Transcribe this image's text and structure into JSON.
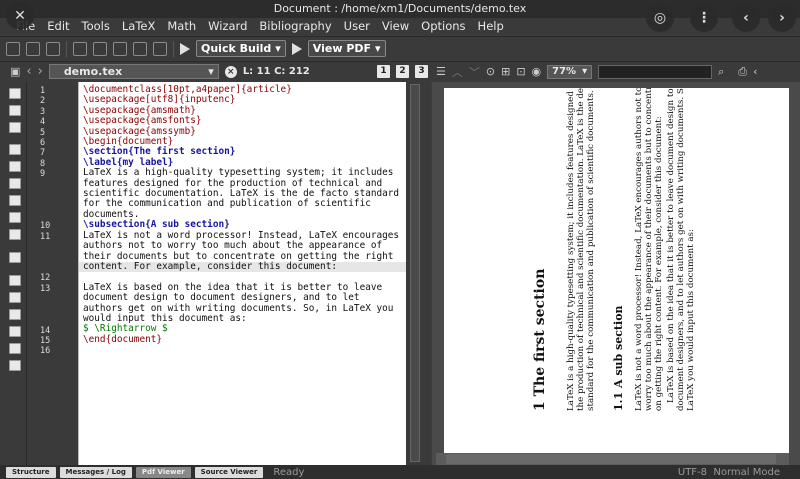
{
  "window": {
    "title": "Document : /home/xm1/Documents/demo.tex"
  },
  "menu": [
    "File",
    "Edit",
    "Tools",
    "LaTeX",
    "Math",
    "Wizard",
    "Bibliography",
    "User",
    "View",
    "Options",
    "Help"
  ],
  "toolbar": {
    "build_label": "Quick Build",
    "view_label": "View PDF"
  },
  "editor_bar": {
    "filename": "demo.tex",
    "position": "L: 11 C: 212",
    "btns": [
      "1",
      "2",
      "3"
    ]
  },
  "viewer_bar": {
    "zoom": "77%"
  },
  "gutter": [
    "1",
    "2",
    "3",
    "4",
    "5",
    "6",
    "7",
    "8",
    "9",
    "10",
    "11",
    "12",
    "13",
    "14",
    "15",
    "16"
  ],
  "source": [
    "\\documentclass[10pt,a4paper]{article}",
    "\\usepackage[utf8]{inputenc}",
    "\\usepackage{amsmath}",
    "\\usepackage{amsfonts}",
    "\\usepackage{amssymb}",
    "\\begin{document}",
    "\\section{The first section}",
    "\\label{my label}",
    "LaTeX is a high-quality typesetting system; it includes",
    "features designed for the production of technical and",
    "scientific documentation. LaTeX is the de facto standard",
    "for the communication and publication of scientific",
    "documents.",
    "\\subsection{A sub section}",
    "LaTeX is not a word processor! Instead, LaTeX encourages",
    "authors not to worry too much about the appearance of",
    "their documents but to concentrate on getting the right",
    "content. For example, consider this document:",
    "",
    "LaTeX is based on the idea that it is better to leave",
    "document design to document designers, and to let",
    "authors get on with writing documents. So, in LaTeX you",
    "would input this document as:",
    "$ \\Rightarrow $",
    "\\end{document}"
  ],
  "pdf": {
    "section": "1   The first section",
    "p1": [
      "LaTeX is a high-quality typesetting system; it includes features designed for",
      "the production of technical and scientific documentation. LaTeX is the de facto",
      "standard for the communication and publication of scientific documents."
    ],
    "subsection": "1.1   A sub section",
    "p2": [
      "LaTeX is not a word processor! Instead, LaTeX encourages authors not to",
      "worry too much about the appearance of their documents but to concentrate",
      "on getting the right content. For example, consider this document:",
      "LaTeX is based on the idea that it is better to leave document design to",
      "document designers, and to let authors get on with writing documents. So, in",
      "LaTeX you would input this document as:"
    ]
  },
  "status": {
    "tabs": [
      "Structure",
      "Messages / Log",
      "Pdf Viewer",
      "Source Viewer"
    ],
    "ready": "Ready",
    "encoding": "UTF-8",
    "mode": "Normal Mode"
  }
}
